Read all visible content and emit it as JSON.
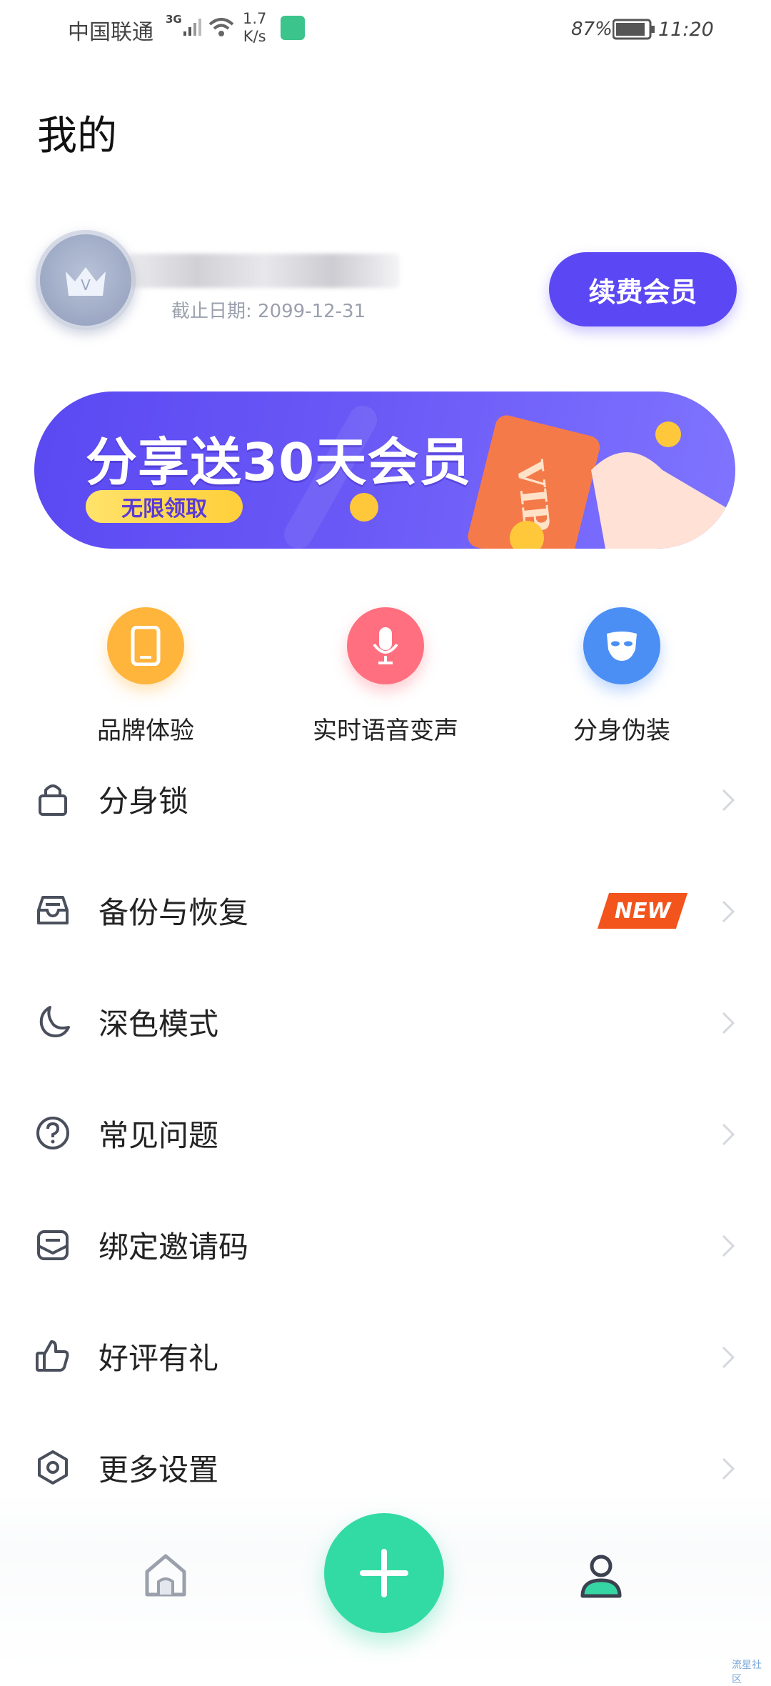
{
  "status_bar": {
    "carrier": "中国联通",
    "network": "3G",
    "speed_value": "1.7",
    "speed_unit": "K/s",
    "battery": "87%",
    "time": "11:20"
  },
  "header": {
    "title": "我的"
  },
  "profile": {
    "expiry": "截止日期: 2099-12-31",
    "renew_label": "续费会员",
    "avatar_letter": "V"
  },
  "banner": {
    "title": "分享送30天会员",
    "tag": "无限领取",
    "card_text": "VIP"
  },
  "quick_actions": [
    {
      "label": "品牌体验",
      "icon": "phone-icon",
      "color": "#ffb43c"
    },
    {
      "label": "实时语音变声",
      "icon": "microphone-icon",
      "color": "#ff6f7f"
    },
    {
      "label": "分身伪装",
      "icon": "mask-icon",
      "color": "#4b8ff5"
    }
  ],
  "menu": [
    {
      "label": "分身锁",
      "icon": "lock-icon"
    },
    {
      "label": "备份与恢复",
      "icon": "inbox-icon",
      "badge": "NEW"
    },
    {
      "label": "深色模式",
      "icon": "moon-icon"
    },
    {
      "label": "常见问题",
      "icon": "question-icon"
    },
    {
      "label": "绑定邀请码",
      "icon": "envelope-icon"
    },
    {
      "label": "好评有礼",
      "icon": "thumbs-up-icon"
    },
    {
      "label": "更多设置",
      "icon": "settings-hexagon-icon"
    }
  ],
  "bottom_nav": {
    "items": [
      "home-icon",
      "add-icon",
      "profile-icon"
    ]
  },
  "watermark": "流星社区"
}
